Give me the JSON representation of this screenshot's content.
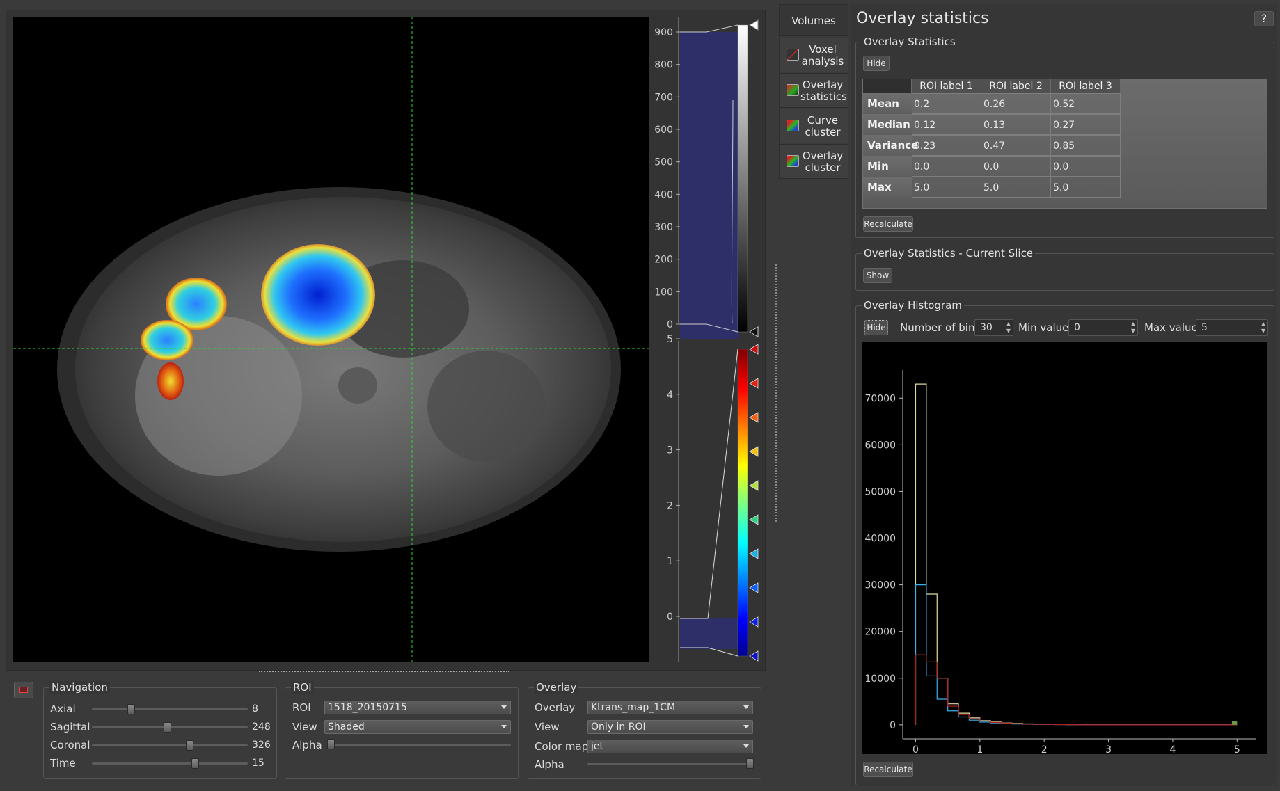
{
  "tabs": [
    {
      "label_line1": "Volumes",
      "label_line2": "",
      "icon": "none"
    },
    {
      "label_line1": "Voxel",
      "label_line2": "analysis",
      "icon": "voxel-analysis-icon"
    },
    {
      "label_line1": "Overlay",
      "label_line2": "statistics",
      "icon": "overlay-statistics-icon"
    },
    {
      "label_line1": "Curve",
      "label_line2": "cluster",
      "icon": "curve-cluster-icon"
    },
    {
      "label_line1": "Overlay",
      "label_line2": "cluster",
      "icon": "overlay-cluster-icon"
    }
  ],
  "panel": {
    "title": "Overlay statistics",
    "help": "?"
  },
  "stats": {
    "group_title": "Overlay Statistics",
    "hide_label": "Hide",
    "recalc_label": "Recalculate",
    "columns": [
      "ROI label 1",
      "ROI label 2",
      "ROI label 3"
    ],
    "rows": [
      {
        "name": "Mean",
        "values": [
          "0.2",
          "0.26",
          "0.52"
        ]
      },
      {
        "name": "Median",
        "values": [
          "0.12",
          "0.13",
          "0.27"
        ]
      },
      {
        "name": "Variance",
        "values": [
          "0.23",
          "0.47",
          "0.85"
        ]
      },
      {
        "name": "Min",
        "values": [
          "0.0",
          "0.0",
          "0.0"
        ]
      },
      {
        "name": "Max",
        "values": [
          "5.0",
          "5.0",
          "5.0"
        ]
      }
    ]
  },
  "current_slice": {
    "group_title": "Overlay Statistics - Current Slice",
    "show_label": "Show"
  },
  "histogram": {
    "group_title": "Overlay Histogram",
    "hide_label": "Hide",
    "bins_label": "Number of bins",
    "bins_value": "30",
    "min_label": "Min value",
    "min_value": "0",
    "max_label": "Max value",
    "max_value": "5",
    "recalc_label": "Recalculate"
  },
  "chart_data": {
    "type": "line",
    "title": "",
    "xlabel": "",
    "ylabel": "",
    "xlim": [
      -0.2,
      5.3
    ],
    "ylim": [
      -3000,
      76000
    ],
    "x_ticks": [
      0,
      1,
      2,
      3,
      4,
      5
    ],
    "y_ticks": [
      0,
      10000,
      20000,
      30000,
      40000,
      50000,
      60000,
      70000
    ],
    "bin_edges": [
      0,
      0.1667,
      0.3333,
      0.5,
      0.6667,
      0.8333,
      1.0,
      1.1667,
      1.3333,
      1.5,
      1.6667,
      1.8333,
      2.0,
      2.1667,
      2.3333,
      2.5
    ],
    "series": [
      {
        "color": "#e0d8a0",
        "values": [
          73000,
          28000,
          10000,
          4500,
          2500,
          1500,
          900,
          600,
          400,
          300,
          200,
          150,
          100,
          80,
          60
        ]
      },
      {
        "color": "#3db0e8",
        "values": [
          30000,
          10500,
          5500,
          3000,
          1700,
          1000,
          600,
          400,
          250,
          180,
          120,
          90,
          70,
          50,
          40
        ]
      },
      {
        "color": "#b02020",
        "values": [
          15000,
          13500,
          10000,
          4000,
          2200,
          1300,
          800,
          500,
          320,
          220,
          150,
          110,
          80,
          60,
          45
        ]
      }
    ]
  },
  "volume_colorbar": {
    "ticks": [
      "900",
      "800",
      "700",
      "600",
      "500",
      "400",
      "300",
      "200",
      "100",
      "0"
    ]
  },
  "overlay_colorbar": {
    "ticks": [
      "5",
      "4",
      "3",
      "2",
      "1",
      "0"
    ]
  },
  "navigation": {
    "group_title": "Navigation",
    "rows": [
      {
        "label": "Axial",
        "value": "8",
        "pos": 0.24
      },
      {
        "label": "Sagittal",
        "value": "248",
        "pos": 0.48
      },
      {
        "label": "Coronal",
        "value": "326",
        "pos": 0.63
      },
      {
        "label": "Time",
        "value": "15",
        "pos": 0.67
      }
    ]
  },
  "roi": {
    "group_title": "ROI",
    "roi_label": "ROI",
    "roi_value": "1518_20150715",
    "view_label": "View",
    "view_value": "Shaded",
    "alpha_label": "Alpha",
    "alpha_pos": 0.0
  },
  "overlay": {
    "group_title": "Overlay",
    "overlay_label": "Overlay",
    "overlay_value": "Ktrans_map_1CM",
    "view_label": "View",
    "view_value": "Only in ROI",
    "cmap_label": "Color map",
    "cmap_value": "jet",
    "alpha_label": "Alpha",
    "alpha_pos": 1.0
  }
}
